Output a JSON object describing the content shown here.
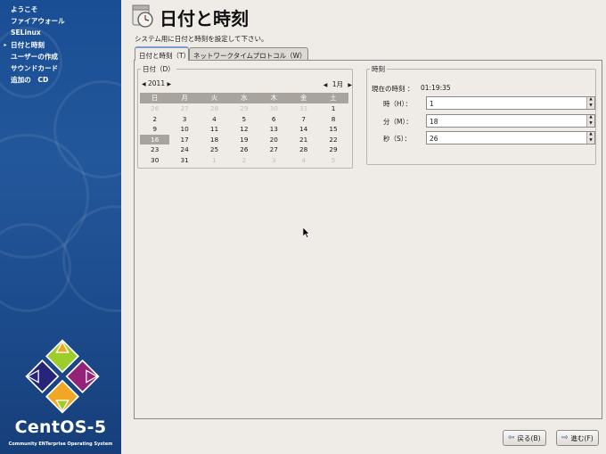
{
  "sidebar": {
    "steps": [
      {
        "label": "ようこそ",
        "current": false
      },
      {
        "label": "ファイアウォール",
        "current": false
      },
      {
        "label": "SELinux",
        "current": false
      },
      {
        "label": "日付と時刻",
        "current": true
      },
      {
        "label": "ユーザーの作成",
        "current": false
      },
      {
        "label": "サウンドカード",
        "current": false
      },
      {
        "label": "追加の　CD",
        "current": false
      }
    ],
    "logo_text": "CentOS-5",
    "logo_subtitle": "Community ENTerprise Operating System"
  },
  "header": {
    "title": "日付と時刻",
    "description": "システム用に日付と時刻を設定して下さい。"
  },
  "tabs": [
    {
      "label": "日付と時刻（T）",
      "active": true
    },
    {
      "label": "ネットワークタイムプロトコル（W）",
      "active": false
    }
  ],
  "date": {
    "frame_label": "日付（D）",
    "year": "2011",
    "month": "1月",
    "weekdays": [
      "日",
      "月",
      "火",
      "水",
      "木",
      "金",
      "土"
    ],
    "weeks": [
      [
        {
          "d": "26",
          "dim": true
        },
        {
          "d": "27",
          "dim": true
        },
        {
          "d": "28",
          "dim": true
        },
        {
          "d": "29",
          "dim": true
        },
        {
          "d": "30",
          "dim": true
        },
        {
          "d": "31",
          "dim": true
        },
        {
          "d": "1",
          "dim": false
        }
      ],
      [
        {
          "d": "2",
          "dim": false
        },
        {
          "d": "3",
          "dim": false
        },
        {
          "d": "4",
          "dim": false
        },
        {
          "d": "5",
          "dim": false
        },
        {
          "d": "6",
          "dim": false
        },
        {
          "d": "7",
          "dim": false
        },
        {
          "d": "8",
          "dim": false
        }
      ],
      [
        {
          "d": "9",
          "dim": false
        },
        {
          "d": "10",
          "dim": false
        },
        {
          "d": "11",
          "dim": false
        },
        {
          "d": "12",
          "dim": false
        },
        {
          "d": "13",
          "dim": false
        },
        {
          "d": "14",
          "dim": false
        },
        {
          "d": "15",
          "dim": false
        }
      ],
      [
        {
          "d": "16",
          "dim": false,
          "sel": true
        },
        {
          "d": "17",
          "dim": false
        },
        {
          "d": "18",
          "dim": false
        },
        {
          "d": "19",
          "dim": false
        },
        {
          "d": "20",
          "dim": false
        },
        {
          "d": "21",
          "dim": false
        },
        {
          "d": "22",
          "dim": false
        }
      ],
      [
        {
          "d": "23",
          "dim": false
        },
        {
          "d": "24",
          "dim": false
        },
        {
          "d": "25",
          "dim": false
        },
        {
          "d": "26",
          "dim": false
        },
        {
          "d": "27",
          "dim": false
        },
        {
          "d": "28",
          "dim": false
        },
        {
          "d": "29",
          "dim": false
        }
      ],
      [
        {
          "d": "30",
          "dim": false
        },
        {
          "d": "31",
          "dim": false
        },
        {
          "d": "1",
          "dim": true
        },
        {
          "d": "2",
          "dim": true
        },
        {
          "d": "3",
          "dim": true
        },
        {
          "d": "4",
          "dim": true
        },
        {
          "d": "5",
          "dim": true
        }
      ]
    ]
  },
  "time": {
    "frame_label": "時刻",
    "current_label": "現在の時刻 ：",
    "current_value": "01:19:35",
    "hour_label": "時（H）：",
    "hour_value": "1",
    "minute_label": "分（M）：",
    "minute_value": "18",
    "second_label": "秒（S）：",
    "second_value": "26"
  },
  "footer": {
    "back_label": "戻る(B)",
    "next_label": "進む(F)"
  },
  "colors": {
    "sidebar_blue": "#1f5298",
    "selection_gray": "#a8a39c",
    "window_bg": "#efebe7"
  }
}
